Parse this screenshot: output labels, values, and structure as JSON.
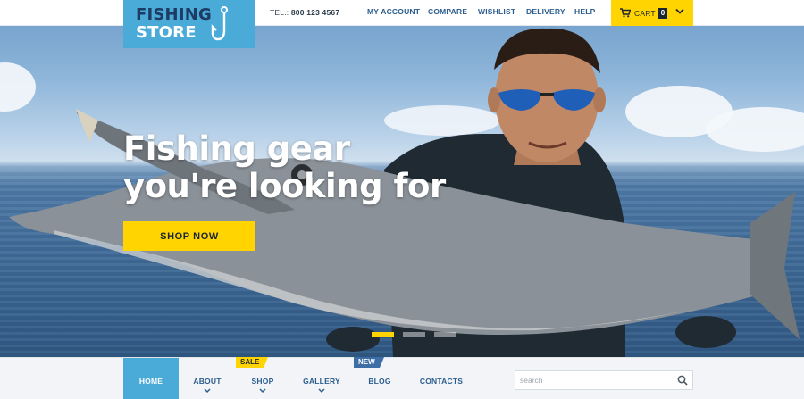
{
  "brand": {
    "line1": "FISHING",
    "line2": "STORE",
    "logo_icon": "fish-hook-icon",
    "colors": {
      "logo_bg": "#4aabd9",
      "accent": "#ffd400",
      "navy": "#1d3b63",
      "link": "#2b5d8e"
    }
  },
  "topbar": {
    "tel_label": "TEL.:",
    "tel_number": "800 123 4567",
    "links": [
      "MY ACCOUNT",
      "COMPARE",
      "WISHLIST",
      "DELIVERY",
      "HELP"
    ],
    "cart": {
      "label": "CART",
      "count": "0",
      "icon": "cart-icon",
      "chevron": "chevron-down-icon"
    }
  },
  "hero": {
    "title_line1": "Fishing gear",
    "title_line2": "you're looking for",
    "cta": "SHOP NOW",
    "slides": {
      "count": 3,
      "active": 1
    }
  },
  "nav": {
    "items": [
      {
        "label": "HOME",
        "active": true,
        "dropdown": false
      },
      {
        "label": "ABOUT",
        "active": false,
        "dropdown": true
      },
      {
        "label": "SHOP",
        "active": false,
        "dropdown": true
      },
      {
        "label": "GALLERY",
        "active": false,
        "dropdown": true
      },
      {
        "label": "BLOG",
        "active": false,
        "dropdown": false
      },
      {
        "label": "CONTACTS",
        "active": false,
        "dropdown": false
      }
    ],
    "badges": {
      "sale": "SALE",
      "new": "NEW"
    },
    "search": {
      "placeholder": "search",
      "value": "",
      "icon": "search-icon"
    }
  }
}
